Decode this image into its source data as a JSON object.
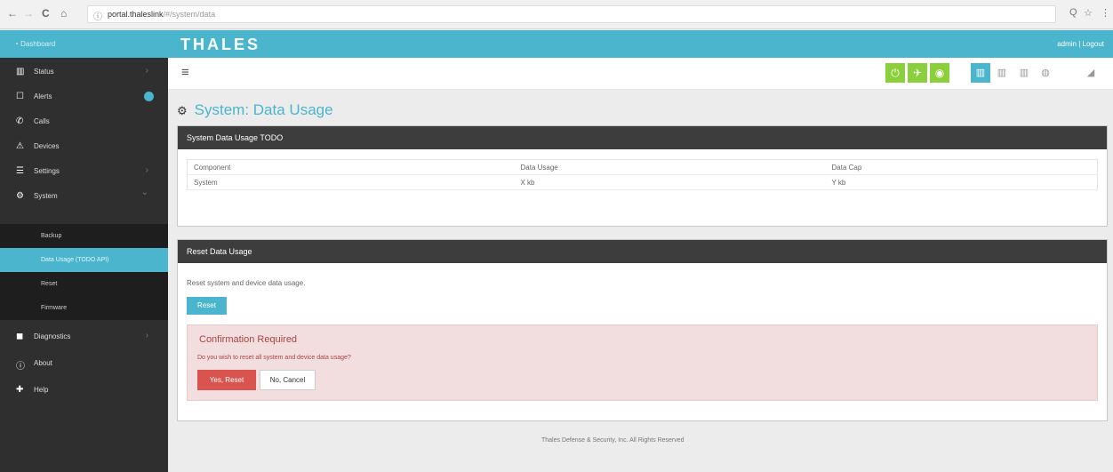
{
  "browser": {
    "back": "←",
    "forward": "→",
    "reload": "C",
    "home": "⌂",
    "info": "ⓘ",
    "url_host": "portal.thaleslink",
    "url_path": "/#/system/data",
    "zoom": "Q",
    "star": "☆",
    "menu": "⋮"
  },
  "topbar": {
    "dashboard_label": "Dashboard",
    "brand": "THALES",
    "user_links": "admin | Logout"
  },
  "sidebar": {
    "items": [
      {
        "label": "Status",
        "icon": "bar-chart-icon",
        "glyph": "▥",
        "has_chevron": true
      },
      {
        "label": "Alerts",
        "icon": "alert-icon",
        "glyph": "☐",
        "has_badge": true
      },
      {
        "label": "Calls",
        "icon": "phone-icon",
        "glyph": "✆"
      },
      {
        "label": "Devices",
        "icon": "devices-icon",
        "glyph": "⚠"
      },
      {
        "label": "Settings",
        "icon": "settings-icon",
        "glyph": "☰",
        "has_chevron": true
      },
      {
        "label": "System",
        "icon": "gear-icon",
        "glyph": "⚙",
        "expanded": true
      }
    ],
    "system_sub": [
      {
        "label": "Backup"
      },
      {
        "label": "Data Usage (TODO API)",
        "active": true
      },
      {
        "label": "Reset"
      },
      {
        "label": "Firmware"
      }
    ],
    "items_after": [
      {
        "label": "Diagnostics",
        "icon": "diagnostics-icon",
        "glyph": "◼",
        "has_chevron": true
      },
      {
        "label": "About",
        "icon": "info-icon",
        "glyph": "ⓘ"
      },
      {
        "label": "Help",
        "icon": "help-icon",
        "glyph": "✚"
      }
    ],
    "chevron_right": "›",
    "chevron_down": "⌄"
  },
  "toolbar": {
    "menu_glyph": "≡",
    "status_icons": [
      {
        "name": "power-status-icon",
        "glyph": "⏻",
        "color": "#8ccf3c"
      },
      {
        "name": "satellite-status-icon",
        "glyph": "✈",
        "color": "#8ccf3c"
      },
      {
        "name": "wifi-status-icon",
        "glyph": "◉",
        "color": "#8ccf3c"
      },
      {
        "name": "signal-bars-icon",
        "glyph": "▥",
        "color": "#4ab5cc"
      },
      {
        "name": "signal-bars-2-icon",
        "glyph": "▥",
        "color": "#999999"
      },
      {
        "name": "signal-bars-3-icon",
        "glyph": "▥",
        "color": "#999999"
      },
      {
        "name": "globe-icon",
        "glyph": "◍",
        "color": "#999999"
      },
      {
        "name": "signal-strength-icon",
        "glyph": "◢",
        "color": "#999999"
      }
    ]
  },
  "page": {
    "title_icon": "⚙",
    "title": "System: Data Usage"
  },
  "usage_panel": {
    "heading": "System Data Usage TODO",
    "columns": [
      "Component",
      "Data Usage",
      "Data Cap"
    ],
    "rows": [
      [
        "System",
        "X kb",
        "Y kb"
      ]
    ]
  },
  "reset_panel": {
    "heading": "Reset Data Usage",
    "description": "Reset system and device data usage.",
    "reset_button": "Reset",
    "confirm_title": "Confirmation Required",
    "confirm_question": "Do you wish to reset all system and device data usage?",
    "yes_button": "Yes, Reset",
    "no_button": "No, Cancel"
  },
  "footer": "Thales Defense & Security, Inc. All Rights Reserved",
  "colors": {
    "accent": "#4ab5cc",
    "sidebar": "#2f2f2f",
    "panel_header": "#3d3d3d",
    "danger": "#d9534f",
    "success": "#8ccf3c"
  }
}
